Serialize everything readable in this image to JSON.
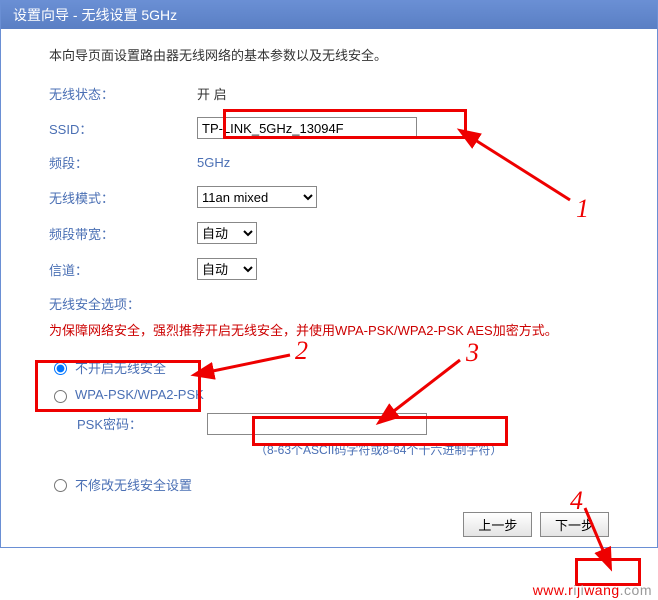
{
  "title": "设置向导 - 无线设置 5GHz",
  "intro": "本向导页面设置路由器无线网络的基本参数以及无线安全。",
  "fields": {
    "status_label": "无线状态：",
    "status_value": "开 启",
    "ssid_label": "SSID：",
    "ssid_value": "TP-LINK_5GHz_13094F",
    "band_label": "频段：",
    "band_value": "5GHz",
    "mode_label": "无线模式：",
    "mode_value": "11an mixed",
    "bandwidth_label": "频段带宽：",
    "bandwidth_value": "自动",
    "channel_label": "信道：",
    "channel_value": "自动"
  },
  "security": {
    "section_label": "无线安全选项：",
    "warning": "为保障网络安全，强烈推荐开启无线安全，并使用WPA-PSK/WPA2-PSK AES加密方式。",
    "opt_none": "不开启无线安全",
    "opt_wpa": "WPA-PSK/WPA2-PSK",
    "psk_label": "PSK密码：",
    "psk_value": "",
    "psk_hint": "（8-63个ASCII码字符或8-64个十六进制字符）",
    "opt_nochange": "不修改无线安全设置"
  },
  "buttons": {
    "prev": "上一步",
    "next": "下一步"
  },
  "annotations": {
    "n1": "1",
    "n2": "2",
    "n3": "3",
    "n4": "4"
  },
  "watermark": "www.rijiwang.com"
}
